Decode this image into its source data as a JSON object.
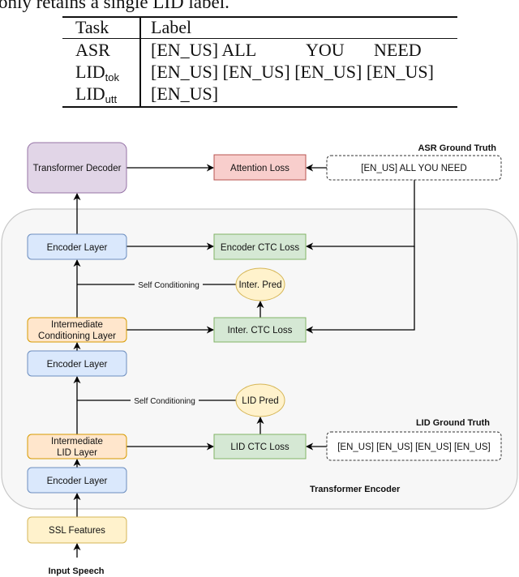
{
  "intro_text": "only retains a single LID label.",
  "table": {
    "headers": [
      "Task",
      "Label"
    ],
    "rows": [
      {
        "task": "ASR",
        "task_sub": "",
        "labels": [
          "[EN_US] ALL",
          "YOU",
          "NEED"
        ]
      },
      {
        "task": "LID",
        "task_sub": "tok",
        "labels": [
          "[EN_US]",
          "[EN_US]",
          "[EN_US]",
          "[EN_US]"
        ]
      },
      {
        "task": "LID",
        "task_sub": "utt",
        "labels": [
          "[EN_US]"
        ]
      }
    ]
  },
  "diagram": {
    "colors": {
      "decoder_fill": "#e1d5e7",
      "decoder_stroke": "#9673a6",
      "loss_attention_fill": "#f8cecc",
      "loss_attention_stroke": "#b85450",
      "ctc_fill": "#d5e8d4",
      "ctc_stroke": "#82b366",
      "encoder_fill": "#dae8fc",
      "encoder_stroke": "#6c8ebf",
      "intermediate_fill": "#ffe6cc",
      "intermediate_stroke": "#d79b00",
      "ssl_fill": "#fff2cc",
      "ssl_stroke": "#d6b656",
      "container_fill": "#f7f7f7",
      "container_stroke": "#c8c8c8"
    },
    "nodes": {
      "transformer_decoder": "Transformer Decoder",
      "attention_loss": "Attention Loss",
      "asr_ground_truth_label": "ASR Ground Truth",
      "asr_ground_truth_value": "[EN_US] ALL YOU NEED",
      "encoder_layer_top": "Encoder Layer",
      "encoder_ctc_loss": "Encoder CTC Loss",
      "self_conditioning_1": "Self Conditioning",
      "inter_pred": "Inter. Pred",
      "intermediate_conditioning_layer": [
        "Intermediate",
        "Conditioning Layer"
      ],
      "inter_ctc_loss": "Inter. CTC Loss",
      "encoder_layer_middle": "Encoder Layer",
      "self_conditioning_2": "Self Conditioning",
      "lid_pred": "LID Pred",
      "lid_ground_truth_label": "LID Ground Truth",
      "lid_ground_truth_value": "[EN_US] [EN_US] [EN_US] [EN_US]",
      "intermediate_lid_layer": [
        "Intermediate",
        "LID Layer"
      ],
      "lid_ctc_loss": "LID CTC Loss",
      "encoder_layer_bottom": "Encoder Layer",
      "transformer_encoder_label": "Transformer Encoder",
      "ssl_features": "SSL Features",
      "input_speech": "Input Speech"
    }
  }
}
